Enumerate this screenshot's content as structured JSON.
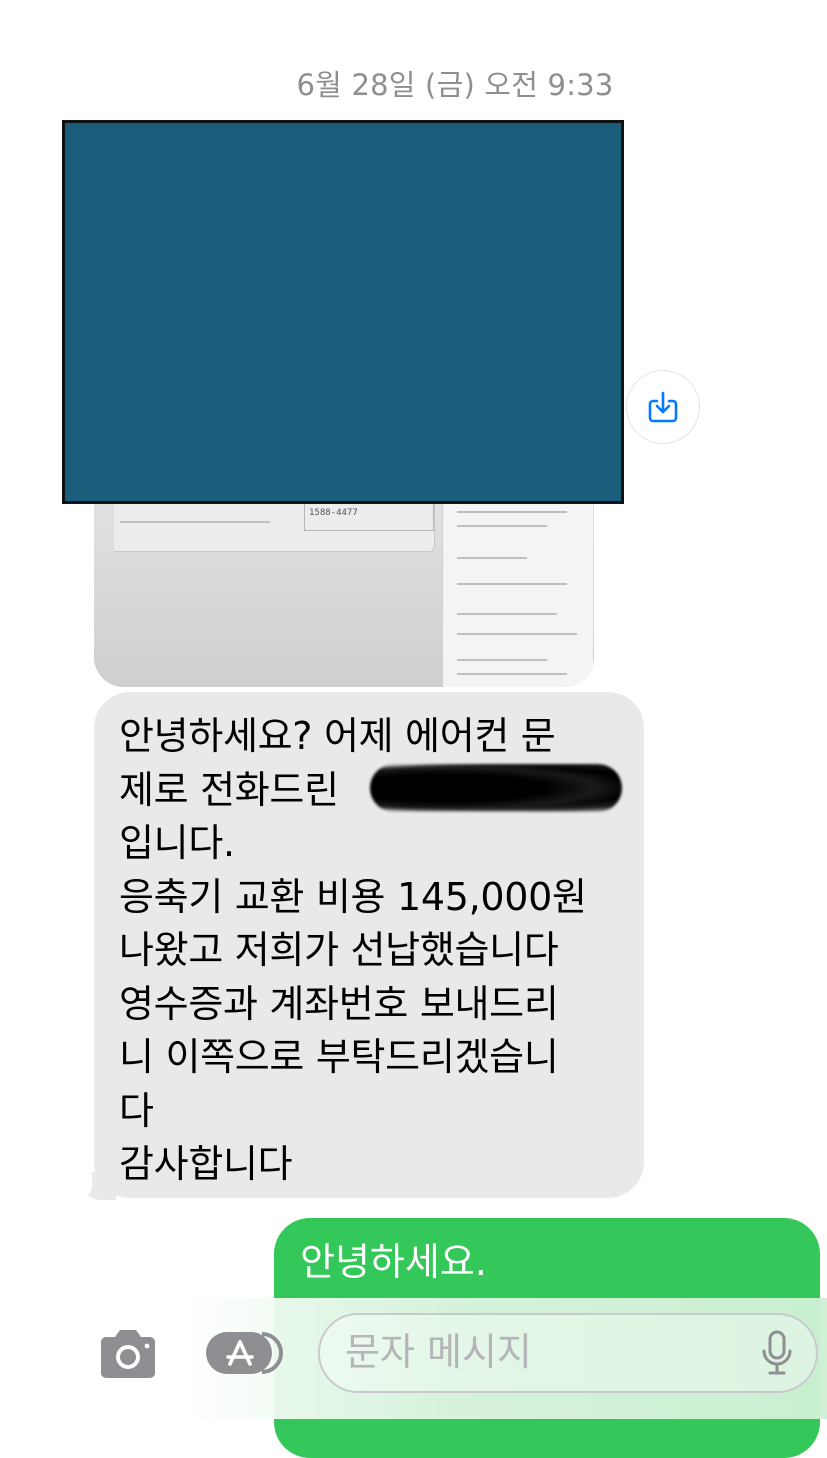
{
  "conversation": {
    "timestamp": "6월 28일 (금) 오전 9:33"
  },
  "image_message": {
    "form_phone_text": "1588-4477"
  },
  "received_message": {
    "text": "안녕하세요? 어제 에어컨 문\n제로 전화드린 \n입니다.\n응축기 교환 비용 145,000원\n나왔고 저희가 선납했습니다\n영수증과 계좌번호 보내드리\n니 이쪽으로 부탁드리겠습니\n다\n감사합니다"
  },
  "sent_message": {
    "text": "안녕하세요."
  },
  "composer": {
    "placeholder": "문자 메시지"
  },
  "icons": {
    "save": "square-and-arrow-down-icon",
    "camera": "camera-icon",
    "apps": "app-store-icon",
    "mic": "microphone-icon"
  },
  "colors": {
    "received_bubble": "#e9e9eb",
    "sent_bubble": "#34c759",
    "accent": "#007aff",
    "redaction": "#1b5e7b"
  }
}
